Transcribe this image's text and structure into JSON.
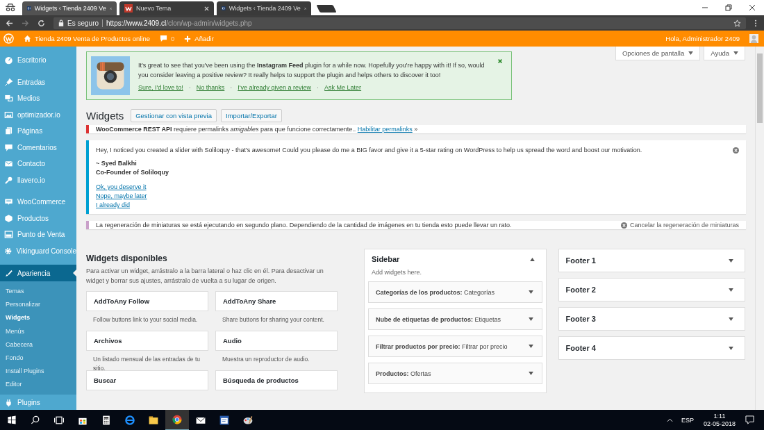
{
  "browser": {
    "tabs": [
      {
        "title": "Widgets ‹ Tienda 2409 Ve",
        "selected": true
      },
      {
        "title": "Nuevo Tema",
        "selected": false
      },
      {
        "title": "Widgets ‹ Tienda 2409 Ve",
        "selected": false
      }
    ],
    "security": "Es seguro",
    "url": {
      "host": "https://www.2409.cl",
      "path": "/clon/wp-admin/widgets.php"
    }
  },
  "admin_bar": {
    "site": "Tienda 2409 Venta de Productos online",
    "comments": "0",
    "new": "Añadir",
    "greeting": "Hola, Administrador 2409"
  },
  "sidebar": {
    "groups": [
      [
        {
          "label": "Escritorio",
          "selected": false
        }
      ],
      [
        {
          "label": "Entradas",
          "selected": false
        },
        {
          "label": "Medios",
          "selected": false
        },
        {
          "label": "optimizador.io",
          "selected": false
        },
        {
          "label": "Páginas",
          "selected": false
        },
        {
          "label": "Comentarios",
          "selected": false
        },
        {
          "label": "Contacto",
          "selected": false
        },
        {
          "label": "llavero.io",
          "selected": false
        }
      ],
      [
        {
          "label": "WooCommerce",
          "selected": false
        },
        {
          "label": "Productos",
          "selected": false
        },
        {
          "label": "Punto de Venta",
          "selected": false
        },
        {
          "label": "Vikinguard Console",
          "selected": false
        }
      ],
      [
        {
          "label": "Apariencia",
          "selected": true,
          "children": [
            {
              "label": "Temas",
              "selected": false
            },
            {
              "label": "Personalizar",
              "selected": false
            },
            {
              "label": "Widgets",
              "selected": true
            },
            {
              "label": "Menús",
              "selected": false
            },
            {
              "label": "Cabecera",
              "selected": false
            },
            {
              "label": "Fondo",
              "selected": false
            },
            {
              "label": "Install Plugins",
              "selected": false
            },
            {
              "label": "Editor",
              "selected": false
            }
          ]
        },
        {
          "label": "Plugins",
          "selected": false
        }
      ]
    ]
  },
  "screen_options": [
    "Opciones de pantalla",
    "Ayuda"
  ],
  "instagram_notice": {
    "text": "It's great to see that you've been using the **Instagram Feed** plugin for a while now. Hopefully you're happy with it!  If so, would you consider leaving a positive review? It really helps to support the plugin and helps others to discover it too!",
    "links": [
      {
        "kind": "link",
        "text": "Sure, I'd love to!"
      },
      {
        "kind": "separator",
        "text": "·"
      },
      {
        "kind": "link",
        "text": "No thanks"
      },
      {
        "kind": "separator",
        "text": "·"
      },
      {
        "kind": "link",
        "text": "I've already given a review"
      },
      {
        "kind": "separator",
        "text": "·"
      },
      {
        "kind": "link",
        "text": "Ask Me Later"
      }
    ]
  },
  "page": {
    "title": "Widgets",
    "buttons": [
      "Gestionar con vista previa",
      "Importar/Exportar"
    ]
  },
  "woocommerce_notice": {
    "text": "**WooCommerce REST API** requiere permalinks *amigables* para que funcione correctamente..",
    "link": "Habilitar permalinks",
    "suffix": "»"
  },
  "soliloquy_notice": {
    "text": "Hey, I noticed you created a slider with Soliloquy - that's awesome! Could you please do me a BIG favor and give it a 5-star rating on WordPress to help us spread the word and boost our motivation.",
    "signature": [
      "~ Syed Balkhi",
      "Co-Founder of Soliloquy"
    ],
    "links": [
      "Ok, you deserve it",
      "Nope, maybe later",
      "I already did"
    ]
  },
  "regeneration_notice": {
    "text": "La regeneración de miniaturas se está ejecutando en segundo plano. Dependiendo de la cantidad de imágenes en tu tienda esto puede llevar un rato.",
    "action": "Cancelar la regeneración de miniaturas"
  },
  "available_widgets": {
    "title": "Widgets disponibles",
    "description": "Para activar un widget, arrástralo a la barra lateral o haz clic en él. Para desactivar un widget y borrar sus ajustes, arrástralo de vuelta a su lugar de origen.",
    "widgets": [
      {
        "title": "AddToAny Follow",
        "description": "Follow buttons link to your social media."
      },
      {
        "title": "AddToAny Share",
        "description": "Share buttons for sharing your content."
      },
      {
        "title": "Archivos",
        "description": "Un listado mensual de las entradas de tu sitio."
      },
      {
        "title": "Audio",
        "description": "Muestra un reproductor de audio."
      },
      {
        "title": "Buscar"
      },
      {
        "title": "Búsqueda de productos"
      }
    ]
  },
  "widget_areas": [
    {
      "title": "Sidebar",
      "expanded": true,
      "description": "Add widgets here.",
      "widgets": [
        "**Categorías de los productos:** Categorías",
        "**Nube de etiquetas de productos:** Etiquetas",
        "**Filtrar productos por precio:** Filtrar por precio",
        "**Productos:** Ofertas"
      ]
    },
    {
      "title": "Footer 1",
      "expanded": false
    },
    {
      "title": "Footer 2",
      "expanded": false
    },
    {
      "title": "Footer 3",
      "expanded": false
    },
    {
      "title": "Footer 4",
      "expanded": false
    }
  ],
  "taskbar": {
    "language": "ESP",
    "time": "1:11",
    "date": "02-05-2018"
  }
}
